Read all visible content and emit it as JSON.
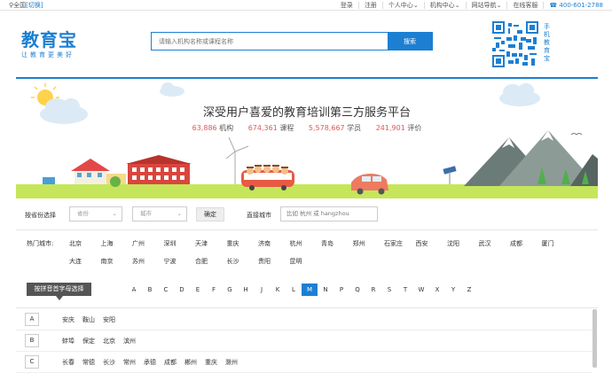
{
  "topbar": {
    "location": "全国",
    "switch": "[切换]",
    "links": [
      "登录",
      "注册",
      "个人中心",
      "机构中心",
      "网站导航",
      "在线客服"
    ],
    "phone": "400-601-2788"
  },
  "logo": {
    "title": "教育宝",
    "slogan": "让教育更美好"
  },
  "search": {
    "placeholder": "请输入机构名称或课程名称",
    "button": "搜索"
  },
  "qr": {
    "label": "手机教育宝"
  },
  "banner": {
    "slogan": "深受用户喜爱的教育培训第三方服务平台",
    "stats": [
      {
        "n": "63,886",
        "u": "机构"
      },
      {
        "n": "674,361",
        "u": "课程"
      },
      {
        "n": "5,578,667",
        "u": "学员"
      },
      {
        "n": "241,901",
        "u": "评价"
      }
    ]
  },
  "filter": {
    "province_label": "按省份选择",
    "province": "省份",
    "city": "城市",
    "ok": "确定",
    "direct_label": "直接城市",
    "city_placeholder": "比如 杭州 或 hangzhou"
  },
  "hot": {
    "label": "热门城市:",
    "row1": [
      "北京",
      "上海",
      "广州",
      "深圳",
      "天津",
      "重庆",
      "济南",
      "杭州",
      "青岛",
      "郑州",
      "石家庄",
      "西安",
      "沈阳",
      "武汉",
      "成都",
      "厦门"
    ],
    "row2": [
      "大连",
      "南京",
      "苏州",
      "宁波",
      "合肥",
      "长沙",
      "贵阳",
      "昆明"
    ]
  },
  "letters": {
    "tip": "按拼音首字母选择",
    "items": [
      "A",
      "B",
      "C",
      "D",
      "E",
      "F",
      "G",
      "H",
      "J",
      "K",
      "L",
      "M",
      "N",
      "P",
      "Q",
      "R",
      "S",
      "T",
      "W",
      "X",
      "Y",
      "Z"
    ],
    "active": "M"
  },
  "provinces": [
    {
      "letter": "A",
      "cities": [
        "安庆",
        "鞍山",
        "安阳"
      ]
    },
    {
      "letter": "B",
      "cities": [
        "蚌埠",
        "保定",
        "北京",
        "滨州"
      ]
    },
    {
      "letter": "C",
      "cities": [
        "长春",
        "常德",
        "长沙",
        "常州",
        "承德",
        "成都",
        "郴州",
        "重庆",
        "滁州"
      ]
    }
  ],
  "colors": {
    "brand": "#1c7fd2",
    "stat": "#e2585b",
    "grass": "#c5e65a"
  }
}
